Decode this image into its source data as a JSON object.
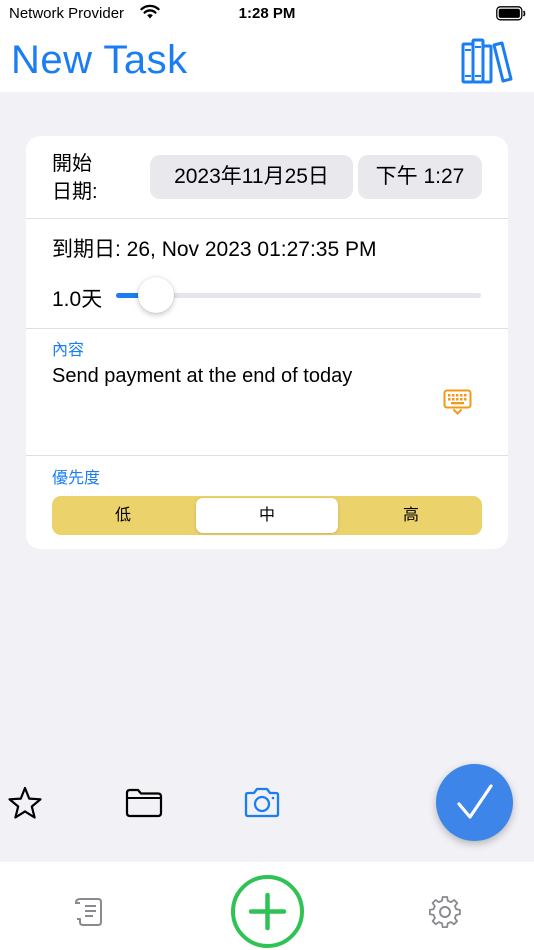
{
  "status_bar": {
    "carrier": "Network Provider",
    "time": "1:28 PM",
    "icons": [
      "wifi-icon",
      "battery-icon"
    ]
  },
  "nav": {
    "title": "New Task",
    "right_icon": "library-icon"
  },
  "form": {
    "start_label": "開始\n日期:",
    "start_date": "2023年11月25日",
    "start_time": "下午 1:27",
    "due": "到期日: 26, Nov 2023 01:27:35 PM",
    "duration_label": "1.0天",
    "duration_slider_fraction": 0.11,
    "content_caption": "內容",
    "content_text": "Send payment at the end of today",
    "priority_caption": "優先度",
    "priority_options": [
      "低",
      "中",
      "高"
    ],
    "priority_selected": "中"
  },
  "toolbar": {
    "icons": [
      "star-icon",
      "folder-icon",
      "camera-icon",
      "checkmark-icon"
    ]
  },
  "tab_bar": {
    "icons": [
      "scroll-icon",
      "plus-icon",
      "gear-icon"
    ]
  },
  "colors": {
    "accent": "#1a7ef2",
    "priority_bg": "#ecd26a",
    "add_green": "#2fc255",
    "confirm_blue": "#3d85e8",
    "keyboard_orange": "#f29a16"
  }
}
